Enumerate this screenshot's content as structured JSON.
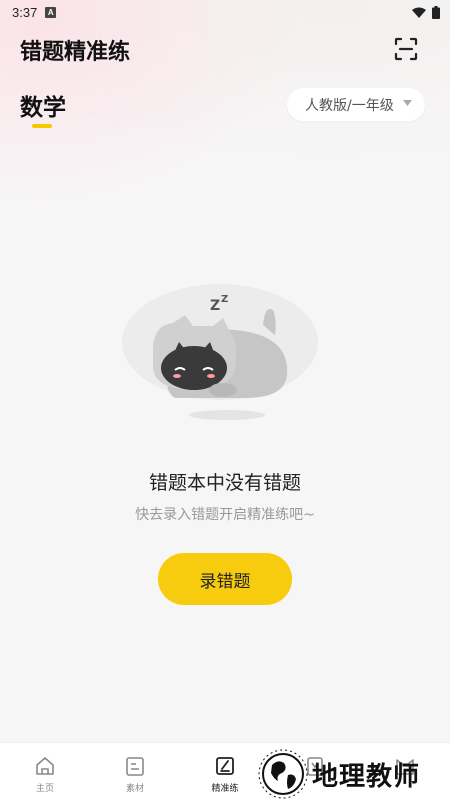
{
  "status_bar": {
    "time": "3:37",
    "notification_letter": "A"
  },
  "header": {
    "title": "错题精准练",
    "scan_icon": "scan-icon"
  },
  "subject_tab": {
    "label": "数学",
    "underline_color": "#f5c800"
  },
  "grade_select": {
    "value": "人教版/一年级",
    "icon": "caret-down-icon"
  },
  "empty_state": {
    "illustration": "sleeping-cat-illustration",
    "title": "错题本中没有错题",
    "subtitle": "快去录入错题开启精准练吧~",
    "button_label": "录错题",
    "button_color": "#f7cc0e"
  },
  "bottom_nav": {
    "items": [
      {
        "label": "主页",
        "icon": "home-icon"
      },
      {
        "label": "素材",
        "icon": "document-icon"
      },
      {
        "label": "精准练",
        "icon": "practice-icon",
        "active": true
      },
      {
        "label": "",
        "icon": "cards-icon"
      },
      {
        "label": "",
        "icon": "cat-profile-icon"
      }
    ]
  },
  "watermark": {
    "text": "地理教师",
    "logo": "earth-globe-logo"
  }
}
